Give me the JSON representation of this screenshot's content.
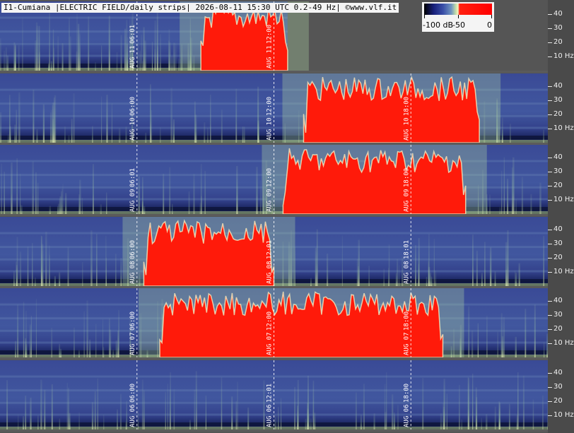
{
  "header": {
    "title": "I1-Cumiana |ELECTRIC FIELD/daily strips| 2026-08-11 15:30 UTC 0.2-49 Hz| ©www.vlf.it"
  },
  "colorbar": {
    "labels": [
      "-100 dB",
      "-50",
      "0"
    ],
    "values_db": [
      -100,
      -50,
      0
    ],
    "colors": [
      "#000000",
      "#18207a",
      "#3a4fa8",
      "#6f95c0",
      "#c8e2a8",
      "#f6f2c2",
      "#ff0000"
    ]
  },
  "chart_data": {
    "type": "heatmap",
    "title": "I1-Cumiana |ELECTRIC FIELD/daily strips| 2026-08-11 15:30 UTC 0.2-49 Hz| ©www.vlf.it",
    "ylabel": "Hz",
    "ylim": [
      0,
      49
    ],
    "y_ticks": [
      {
        "value": 40,
        "label": "40"
      },
      {
        "value": 30,
        "label": "30"
      },
      {
        "value": 20,
        "label": "20"
      },
      {
        "value": 10,
        "label": "10 Hz"
      }
    ],
    "colorscale_db": [
      -100,
      0
    ],
    "strips": [
      {
        "date": "AUG 11",
        "time_markers": [
          "06:01",
          "12:00"
        ],
        "red_span_hours": [
          8.8,
          12.6
        ],
        "data_end_hours": 12.6
      },
      {
        "date": "AUG 10",
        "time_markers": [
          "06:00",
          "12:00",
          "18:00"
        ],
        "red_span_hours": [
          13.3,
          21.0
        ]
      },
      {
        "date": "AUG 09",
        "time_markers": [
          "06:01",
          "12:00",
          "18:00"
        ],
        "red_span_hours": [
          12.4,
          20.4
        ]
      },
      {
        "date": "AUG 08",
        "time_markers": [
          "06:00",
          "12:01",
          "18:01"
        ],
        "red_span_hours": [
          6.3,
          12.0
        ]
      },
      {
        "date": "AUG 07",
        "time_markers": [
          "06:00",
          "12:00",
          "18:00"
        ],
        "red_span_hours": [
          7.0,
          19.4
        ]
      },
      {
        "date": "AUG 06",
        "time_markers": [
          "06:00",
          "12:01",
          "18:00"
        ],
        "red_span_hours": null
      }
    ]
  }
}
